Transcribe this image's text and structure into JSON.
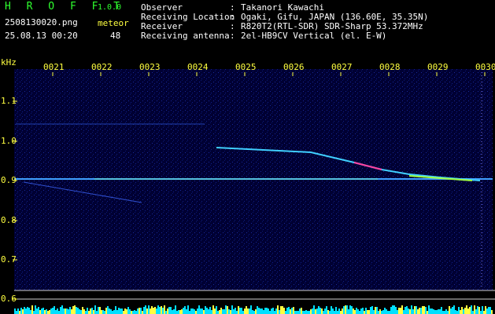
{
  "header": {
    "app_name": "H R O F F T",
    "version": "1.0.0",
    "filename": "2508130020.png",
    "timestamp": "25.08.13 00:20",
    "meteor_label": "meteor",
    "meteor_count": "48"
  },
  "info": {
    "rows": [
      {
        "label": "Observer",
        "sep": ":",
        "value": "Takanori Kawachi"
      },
      {
        "label": "Receiving Location",
        "sep": ":",
        "value": "Ogaki, Gifu, JAPAN (136.60E, 35.35N)"
      },
      {
        "label": "Receiver",
        "sep": ":",
        "value": "R820T2(RTL-SDR) SDR-Sharp 53.372MHz"
      },
      {
        "label": "Receiving antenna",
        "sep": ":",
        "value": "2el-HB9CV Vertical (el. E-W)"
      }
    ]
  },
  "axis": {
    "unit": "kHz",
    "y_ticks": [
      "1.1",
      "1.0",
      "0.9",
      "0.8",
      "0.7",
      "0.6"
    ],
    "x_ticks": [
      "0021",
      "0022",
      "0023",
      "0024",
      "0025",
      "0026",
      "0027",
      "0028",
      "0029",
      "0030"
    ]
  },
  "colors": {
    "label_green": "#2fff2f",
    "background": "#00003a",
    "signal": "#ffff40",
    "activity_bar": "#00e0ff"
  }
}
